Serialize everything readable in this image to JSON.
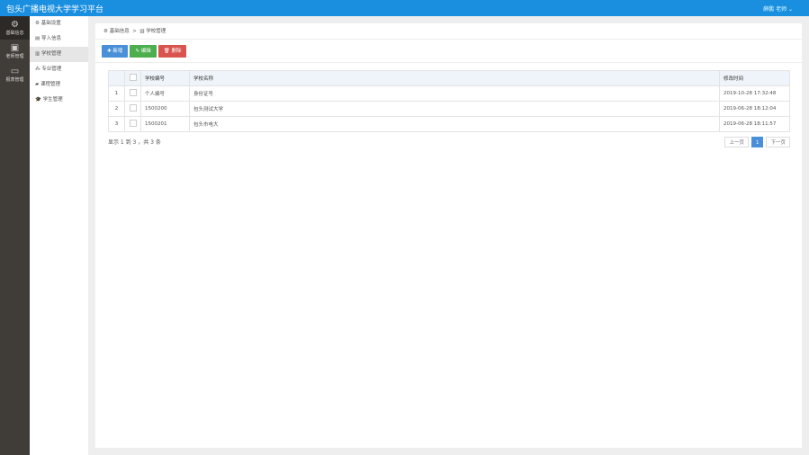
{
  "header": {
    "title": "包头广播电视大学学习平台",
    "user": "薛鹏 老师 ⌄"
  },
  "nav1": [
    {
      "label": "基础信息",
      "icon": "gears-icon"
    },
    {
      "label": "老师管理",
      "icon": "user-icon"
    },
    {
      "label": "报表管理",
      "icon": "id-card-icon"
    }
  ],
  "nav2": [
    {
      "label": "基础设置",
      "icon": "⚙"
    },
    {
      "label": "导入信息",
      "icon": "▤"
    },
    {
      "label": "学校管理",
      "icon": "▥"
    },
    {
      "label": "专业管理",
      "icon": "⁂"
    },
    {
      "label": "课程管理",
      "icon": "▰"
    },
    {
      "label": "学生管理",
      "icon": "🎓"
    }
  ],
  "breadcrumb": {
    "root": "基础信息",
    "sep": ">",
    "current": "学校管理"
  },
  "toolbar": {
    "add": "✚ 新增",
    "edit": "✎ 编辑",
    "delete": "🗑 删除",
    "colors": {
      "add": "#4a90d9",
      "edit": "#4cae4c",
      "delete": "#d9534f"
    }
  },
  "table": {
    "headers": [
      "",
      "",
      "学校编号",
      "学校名称",
      "修改时间"
    ],
    "rows": [
      [
        "1",
        "个人编号",
        "身份证号",
        "2019-10-28 17:32:48"
      ],
      [
        "2",
        "1500200",
        "包头测试大学",
        "2019-06-28 18:12:04"
      ],
      [
        "3",
        "1500201",
        "包头市电大",
        "2019-06-28 18:11:57"
      ]
    ]
  },
  "footer": {
    "info": "显示 1 到 3 ，共 3 条",
    "prev": "上一页",
    "page": "1",
    "next": "下一页"
  }
}
